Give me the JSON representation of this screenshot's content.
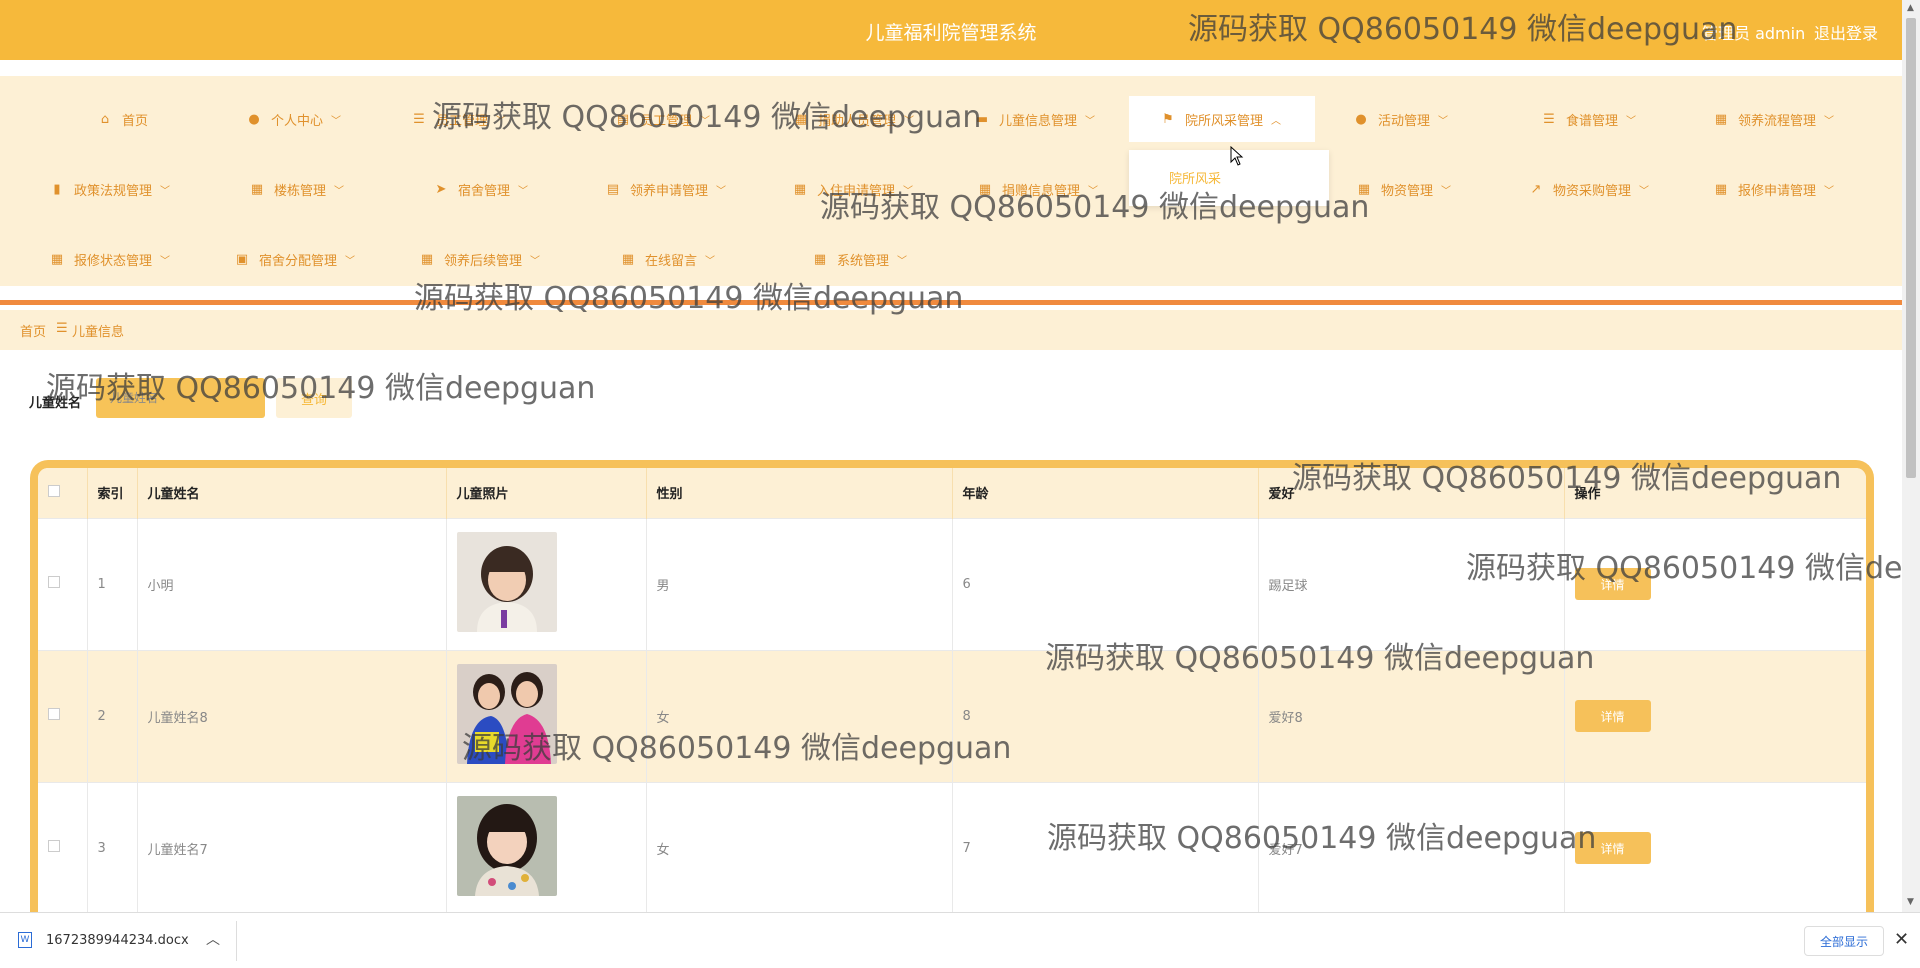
{
  "header": {
    "title": "儿童福利院管理系统",
    "admin": "管理员 admin",
    "logout": "退出登录"
  },
  "nav": [
    {
      "label": "首页",
      "icon": "home-icon",
      "chev": false
    },
    {
      "label": "个人中心",
      "icon": "user-icon",
      "chev": true
    },
    {
      "label": "员工管理",
      "icon": "menu-icon",
      "chev": true
    },
    {
      "label": "员工管理",
      "icon": "doc-icon",
      "chev": true
    },
    {
      "label": "捐助人员管理",
      "icon": "grid-icon",
      "chev": true
    },
    {
      "label": "儿童信息管理",
      "icon": "monitor-icon",
      "chev": true
    },
    {
      "label": "院所风采管理",
      "icon": "flag-icon",
      "chev": true,
      "active": true
    },
    {
      "label": "活动管理",
      "icon": "user-icon",
      "chev": true
    },
    {
      "label": "食谱管理",
      "icon": "menu-icon",
      "chev": true
    },
    {
      "label": "领养流程管理",
      "icon": "grid-icon",
      "chev": true
    },
    {
      "label": "政策法规管理",
      "icon": "bar-chart-icon",
      "chev": true
    },
    {
      "label": "楼栋管理",
      "icon": "grid-icon",
      "chev": true
    },
    {
      "label": "宿舍管理",
      "icon": "send-icon",
      "chev": true
    },
    {
      "label": "领养申请管理",
      "icon": "clipboard-icon",
      "chev": true
    },
    {
      "label": "入住申请管理",
      "icon": "grid-icon",
      "chev": true
    },
    {
      "label": "捐赠信息管理",
      "icon": "grid-icon",
      "chev": true
    },
    {
      "label": "物资管理",
      "icon": "grid-icon",
      "chev": true
    },
    {
      "label": "物资采购管理",
      "icon": "line-chart-icon",
      "chev": true
    },
    {
      "label": "报修申请管理",
      "icon": "grid-icon",
      "chev": true
    },
    {
      "label": "报修状态管理",
      "icon": "grid-icon",
      "chev": true
    },
    {
      "label": "宿舍分配管理",
      "icon": "briefcase-icon",
      "chev": true
    },
    {
      "label": "领养后续管理",
      "icon": "grid-icon",
      "chev": true
    },
    {
      "label": "在线留言",
      "icon": "grid-icon",
      "chev": true
    },
    {
      "label": "系统管理",
      "icon": "grid-icon",
      "chev": true
    }
  ],
  "dropdown": {
    "item": "院所风采"
  },
  "breadcrumb": {
    "home": "首页",
    "sep": "☰",
    "current": "儿童信息"
  },
  "search": {
    "label": "儿童姓名",
    "placeholder": "儿童姓名",
    "button": "查询"
  },
  "table": {
    "columns": [
      "索引",
      "儿童姓名",
      "儿童照片",
      "性别",
      "年龄",
      "爱好",
      "操作"
    ],
    "rows": [
      {
        "index": "1",
        "name": "小明",
        "gender": "男",
        "age": "6",
        "hobby": "踢足球",
        "action": "详情"
      },
      {
        "index": "2",
        "name": "儿童姓名8",
        "gender": "女",
        "age": "8",
        "hobby": "爱好8",
        "action": "详情"
      },
      {
        "index": "3",
        "name": "儿童姓名7",
        "gender": "女",
        "age": "7",
        "hobby": "爱好7",
        "action": "详情"
      }
    ]
  },
  "watermark": "源码获取 QQ86050149 微信deepguan",
  "download": {
    "file": "1672389944234.docx",
    "show_all": "全部显示"
  }
}
